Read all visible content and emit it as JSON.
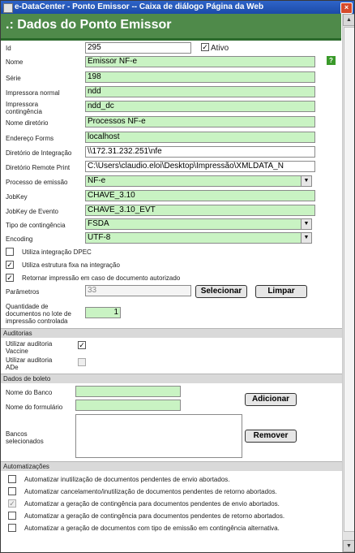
{
  "window": {
    "title": "e-DataCenter - Ponto Emissor -- Caixa de diálogo Página da Web",
    "close_glyph": "×"
  },
  "page_title": ".: Dados do Ponto Emissor",
  "help_glyph": "?",
  "fields": {
    "id": {
      "label": "Id",
      "value": "295"
    },
    "ativo": {
      "label": "Ativo",
      "checked": true
    },
    "nome": {
      "label": "Nome",
      "value": "Emissor NF-e"
    },
    "serie": {
      "label": "Série",
      "value": "198"
    },
    "impressora_normal": {
      "label": "Impressora normal",
      "value": "ndd"
    },
    "impressora_contingencia": {
      "label_line1": "Impressora",
      "label_line2": "contingência",
      "value": "ndd_dc"
    },
    "nome_diretorio": {
      "label": "Nome diretório",
      "value": "Processos NF-e"
    },
    "endereco_forms": {
      "label": "Endereço Forms",
      "value": "localhost"
    },
    "diretorio_integracao": {
      "label": "Diretório de Integração",
      "value": "\\\\172.31.232.251\\nfe"
    },
    "diretorio_remote_print": {
      "label": "Diretório Remote Print",
      "value": "C:\\Users\\claudio.eloi\\Desktop\\Impressão\\XMLDATA_N"
    },
    "processo_emissao": {
      "label": "Processo de emissão",
      "value": "NF-e"
    },
    "jobkey": {
      "label": "JobKey",
      "value": "CHAVE_3.10"
    },
    "jobkey_evento": {
      "label": "JobKey de Evento",
      "value": "CHAVE_3.10_EVT"
    },
    "tipo_contingencia": {
      "label": "Tipo de contingência",
      "value": "FSDA"
    },
    "encoding": {
      "label": "Encoding",
      "value": "UTF-8"
    }
  },
  "checkboxes": [
    {
      "label": "Utiliza integração DPEC",
      "checked": false
    },
    {
      "label": "Utiliza estrutura fixa na integração",
      "checked": true
    },
    {
      "label": "Retornar impressão em caso de documento autorizado",
      "checked": true
    }
  ],
  "parametros": {
    "label": "Parâmetros",
    "value": "33",
    "select_label": "Selecionar",
    "clear_label": "Limpar"
  },
  "quantidade": {
    "label_line1": "Quantidade de",
    "label_line2": "documentos no lote de",
    "label_line3": "impressão controlada",
    "value": "1"
  },
  "auditorias": {
    "section_title": "Auditorias",
    "vaccine": {
      "label_line1": "Utilizar auditoria",
      "label_line2": "Vaccine",
      "checked": true
    },
    "ade": {
      "label_line1": "Utilizar auditoria",
      "label_line2": "ADe",
      "checked": false
    }
  },
  "boleto": {
    "section_title": "Dados de boleto",
    "banco_label": "Nome do Banco",
    "banco_value": "",
    "formulario_label": "Nome do formulário",
    "formulario_value": "",
    "add_label": "Adicionar",
    "bancos_label_line1": "Bancos",
    "bancos_label_line2": "selecionados",
    "remove_label": "Remover"
  },
  "automatizacoes": {
    "section_title": "Automatizações",
    "items": [
      {
        "label": "Automatizar inutilização de documentos pendentes de envio abortados.",
        "checked": false
      },
      {
        "label": "Automatizar cancelamento/inutilização de documentos pendentes de retorno abortados.",
        "checked": false
      },
      {
        "label": "Automatizar a geração de contingência para documentos pendentes de envio abortados.",
        "checked": true
      },
      {
        "label": "Automatizar a geração de contingência para documentos pendentes de retorno abortados.",
        "checked": false
      },
      {
        "label": "Automatizar a geração de documentos com tipo de emissão em contingência alternativa.",
        "checked": false
      }
    ]
  },
  "check_glyph": "✓",
  "arrow_glyph": "▼",
  "scroll_up_glyph": "▲",
  "scroll_down_glyph": "▼"
}
